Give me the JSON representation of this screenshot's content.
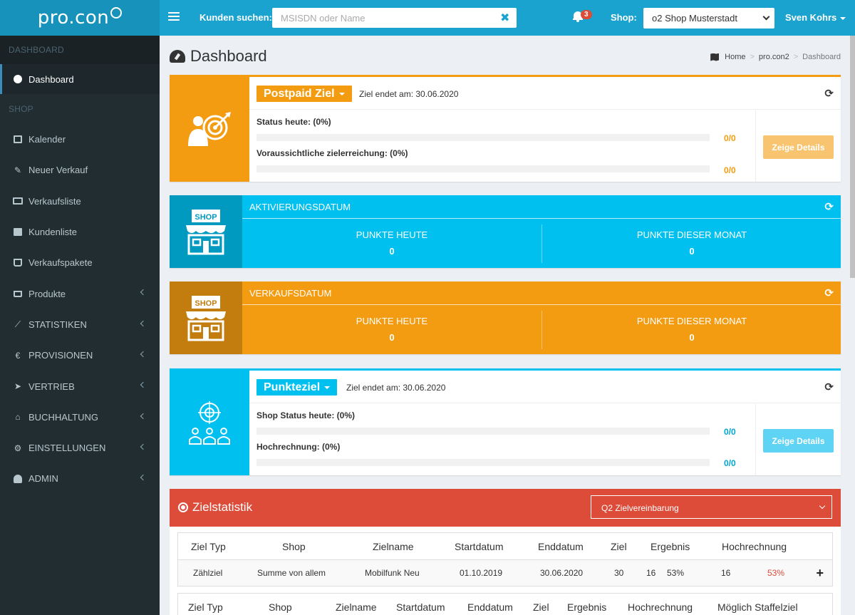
{
  "header": {
    "logo": "pro.con",
    "search_label": "Kunden suchen:",
    "search_placeholder": "MSISDN oder Name",
    "search_clear": "✖",
    "notification_count": "3",
    "shop_label": "Shop:",
    "shop_selected": "o2 Shop Musterstadt",
    "user_name": "Sven Kohrs"
  },
  "sidebar": {
    "section_dashboard": "DASHBOARD",
    "section_shop": "SHOP",
    "items": [
      {
        "label": "Dashboard"
      },
      {
        "label": "Kalender"
      },
      {
        "label": "Neuer Verkauf"
      },
      {
        "label": "Verkaufsliste"
      },
      {
        "label": "Kundenliste"
      },
      {
        "label": "Verkaufspakete"
      },
      {
        "label": "Produkte"
      },
      {
        "label": "STATISTIKEN"
      },
      {
        "label": "PROVISIONEN"
      },
      {
        "label": "VERTRIEB"
      },
      {
        "label": "BUCHHALTUNG"
      },
      {
        "label": "EINSTELLUNGEN"
      },
      {
        "label": "ADMIN"
      }
    ]
  },
  "page": {
    "title": "Dashboard",
    "breadcrumb": [
      "Home",
      "pro.con2",
      "Dashboard"
    ]
  },
  "postpaid": {
    "dropdown": "Postpaid Ziel",
    "end_text": "Ziel endet am: 30.06.2020",
    "status_label": "Status heute: (0%)",
    "status_value": "0/0",
    "status_progress": 0,
    "forecast_label": "Voraussichtliche zielerreichung: (0%)",
    "forecast_value": "0/0",
    "forecast_progress": 0,
    "details_button": "Zeige Details",
    "accent": "#f39c12",
    "button_color": "#f8c46f"
  },
  "aktivierung": {
    "title": "AKTIVIERUNGSDATUM",
    "shop_sign": "SHOP",
    "today_label": "PUNKTE HEUTE",
    "today_value": "0",
    "month_label": "PUNKTE DIESER MONAT",
    "month_value": "0",
    "color": "#00c0ef",
    "icon_bg": "#0099bf"
  },
  "verkauf": {
    "title": "VERKAUFSDATUM",
    "shop_sign": "SHOP",
    "today_label": "PUNKTE HEUTE",
    "today_value": "0",
    "month_label": "PUNKTE DIESER MONAT",
    "month_value": "0",
    "color": "#f39c12",
    "icon_bg": "#c27d0e"
  },
  "punkteziel": {
    "dropdown": "Punkteziel",
    "end_text": "Ziel endet am: 30.06.2020",
    "status_label": "Shop Status heute: (0%)",
    "status_value": "0/0",
    "status_progress": 0,
    "forecast_label": "Hochrechnung: (0%)",
    "forecast_value": "0/0",
    "forecast_progress": 0,
    "details_button": "Zeige Details",
    "accent": "#00c0ef",
    "button_color": "#5fd3f3"
  },
  "zielstatistik": {
    "title": "Zielstatistik",
    "select": "Q2 Zielvereinbarung",
    "table1_headers": [
      "Ziel Typ",
      "Shop",
      "Zielname",
      "Startdatum",
      "Enddatum",
      "Ziel",
      "Ergebnis",
      "Hochrechnung"
    ],
    "table1_row": [
      "Zählziel",
      "Summe von allem",
      "Mobilfunk Neu",
      "01.10.2019",
      "30.06.2020",
      "30",
      "16",
      "53%",
      "16",
      "53%"
    ],
    "expand_icon": "+",
    "table2_headers": [
      "Ziel Typ",
      "Shop",
      "Zielname",
      "Startdatum",
      "Enddatum",
      "Ziel",
      "Ergebnis",
      "Hochrechnung",
      "Möglich Staffelziel"
    ]
  }
}
